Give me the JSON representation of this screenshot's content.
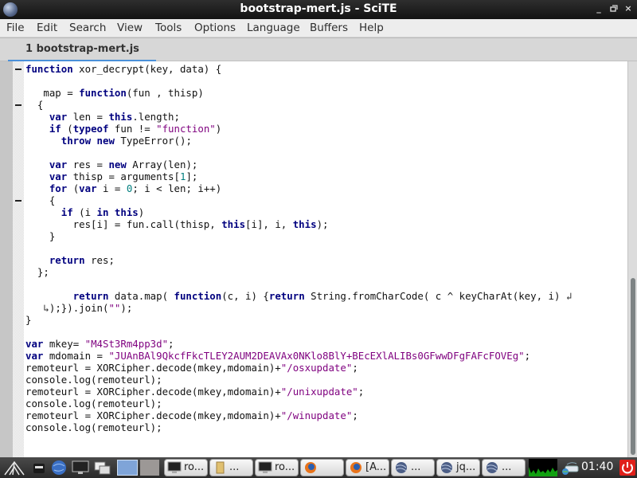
{
  "window": {
    "title": "bootstrap-mert.js - SciTE",
    "controls": {
      "minimize": "_",
      "maximize": "□",
      "close": "×"
    }
  },
  "menu": [
    "File",
    "Edit",
    "Search",
    "View",
    "Tools",
    "Options",
    "Language",
    "Buffers",
    "Help"
  ],
  "tabs": [
    {
      "label": "1 bootstrap-mert.js",
      "active": true
    }
  ],
  "editor": {
    "lines": [
      [
        [
          "kw",
          "function"
        ],
        [
          "p",
          " xor_decrypt(key, data) {"
        ]
      ],
      [],
      [
        [
          "p",
          "   map = "
        ],
        [
          "kw",
          "function"
        ],
        [
          "p",
          "(fun , thisp)"
        ]
      ],
      [
        [
          "p",
          "  {"
        ]
      ],
      [
        [
          "p",
          "    "
        ],
        [
          "kw",
          "var"
        ],
        [
          "p",
          " len = "
        ],
        [
          "kw",
          "this"
        ],
        [
          "p",
          ".length;"
        ]
      ],
      [
        [
          "p",
          "    "
        ],
        [
          "kw",
          "if"
        ],
        [
          "p",
          " ("
        ],
        [
          "kw",
          "typeof"
        ],
        [
          "p",
          " fun != "
        ],
        [
          "str",
          "\"function\""
        ],
        [
          "p",
          ")"
        ]
      ],
      [
        [
          "p",
          "      "
        ],
        [
          "kw",
          "throw"
        ],
        [
          "p",
          " "
        ],
        [
          "kw",
          "new"
        ],
        [
          "p",
          " TypeError();"
        ]
      ],
      [],
      [
        [
          "p",
          "    "
        ],
        [
          "kw",
          "var"
        ],
        [
          "p",
          " res = "
        ],
        [
          "kw",
          "new"
        ],
        [
          "p",
          " Array(len);"
        ]
      ],
      [
        [
          "p",
          "    "
        ],
        [
          "kw",
          "var"
        ],
        [
          "p",
          " thisp = arguments["
        ],
        [
          "num",
          "1"
        ],
        [
          "p",
          "];"
        ]
      ],
      [
        [
          "p",
          "    "
        ],
        [
          "kw",
          "for"
        ],
        [
          "p",
          " ("
        ],
        [
          "kw",
          "var"
        ],
        [
          "p",
          " i = "
        ],
        [
          "num",
          "0"
        ],
        [
          "p",
          "; i < len; i++)"
        ]
      ],
      [
        [
          "p",
          "    {"
        ]
      ],
      [
        [
          "p",
          "      "
        ],
        [
          "kw",
          "if"
        ],
        [
          "p",
          " (i "
        ],
        [
          "kw",
          "in"
        ],
        [
          "p",
          " "
        ],
        [
          "kw",
          "this"
        ],
        [
          "p",
          ")"
        ]
      ],
      [
        [
          "p",
          "        res[i] = fun.call(thisp, "
        ],
        [
          "kw",
          "this"
        ],
        [
          "p",
          "[i], i, "
        ],
        [
          "kw",
          "this"
        ],
        [
          "p",
          ");"
        ]
      ],
      [
        [
          "p",
          "    }"
        ]
      ],
      [],
      [
        [
          "p",
          "    "
        ],
        [
          "kw",
          "return"
        ],
        [
          "p",
          " res;"
        ]
      ],
      [
        [
          "p",
          "  };"
        ]
      ],
      [],
      [
        [
          "p",
          "        "
        ],
        [
          "kw",
          "return"
        ],
        [
          "p",
          " data.map( "
        ],
        [
          "kw",
          "function"
        ],
        [
          "p",
          "(c, i) {"
        ],
        [
          "kw",
          "return"
        ],
        [
          "p",
          " String.fromCharCode( c ^ keyCharAt(key, i) "
        ],
        [
          "wrap",
          "↲"
        ]
      ],
      [
        [
          "p",
          "   "
        ],
        [
          "wrap",
          "↳"
        ],
        [
          "p",
          ");}).join("
        ],
        [
          "str",
          "\"\""
        ],
        [
          "p",
          ");"
        ]
      ],
      [
        [
          "p",
          "}"
        ]
      ],
      [],
      [
        [
          "kw",
          "var"
        ],
        [
          "p",
          " mkey= "
        ],
        [
          "str",
          "\"M4St3Rm4pp3d\""
        ],
        [
          "p",
          ";"
        ]
      ],
      [
        [
          "kw",
          "var"
        ],
        [
          "p",
          " mdomain = "
        ],
        [
          "str",
          "\"JUAnBAl9QkcfFkcTLEY2AUM2DEAVAx0NKlo8BlY+BEcEXlALIBs0GFwwDFgFAFcFOVEg\""
        ],
        [
          "p",
          ";"
        ]
      ],
      [
        [
          "p",
          "remoteurl = XORCipher.decode(mkey,mdomain)+"
        ],
        [
          "str",
          "\"/osxupdate\""
        ],
        [
          "p",
          ";"
        ]
      ],
      [
        [
          "p",
          "console.log(remoteurl);"
        ]
      ],
      [
        [
          "p",
          "remoteurl = XORCipher.decode(mkey,mdomain)+"
        ],
        [
          "str",
          "\"/unixupdate\""
        ],
        [
          "p",
          ";"
        ]
      ],
      [
        [
          "p",
          "console.log(remoteurl);"
        ]
      ],
      [
        [
          "p",
          "remoteurl = XORCipher.decode(mkey,mdomain)+"
        ],
        [
          "str",
          "\"/winupdate\""
        ],
        [
          "p",
          ";"
        ]
      ],
      [
        [
          "p",
          "console.log(remoteurl);"
        ]
      ]
    ],
    "fold_lines": [
      0,
      3,
      11
    ]
  },
  "taskbar": {
    "launchers": [
      "start-menu",
      "show-desktop",
      "web-browser",
      "terminal",
      "window-switcher",
      "workspace-1",
      "workspace-2"
    ],
    "buttons": [
      {
        "label": "ro...",
        "icon": "terminal-icon"
      },
      {
        "label": "...",
        "icon": "folder-icon"
      },
      {
        "label": "ro...",
        "icon": "terminal-icon"
      },
      {
        "label": "",
        "icon": "firefox-icon"
      },
      {
        "label": "[A...",
        "icon": "firefox-icon"
      },
      {
        "label": "...",
        "icon": "scite-icon"
      },
      {
        "label": "jq...",
        "icon": "scite-icon"
      },
      {
        "label": "...",
        "icon": "scite-icon"
      }
    ],
    "clock": "01:40"
  },
  "colors": {
    "keyword": "#00007f",
    "string": "#7f007f",
    "number": "#007f7f",
    "tab_accent": "#4a90d9",
    "power": "#e0201a"
  }
}
